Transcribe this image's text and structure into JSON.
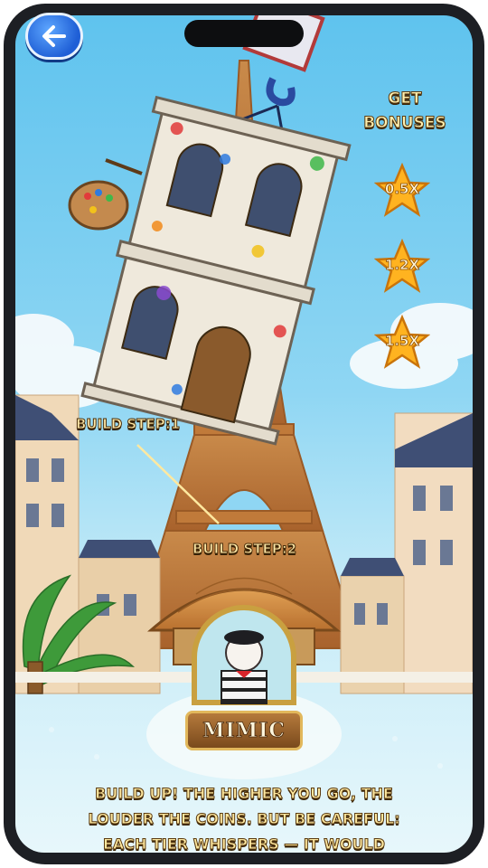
{
  "header": {
    "back_icon": "arrow-left-icon"
  },
  "bonuses": {
    "title_line1": "GET",
    "title_line2": "BONUSES",
    "items": [
      {
        "label": "0.5X"
      },
      {
        "label": "1.2X"
      },
      {
        "label": "1.5X"
      }
    ]
  },
  "build_steps": {
    "step1": "BUILD STEP:1",
    "step2": "BUILD STEP:2"
  },
  "character": {
    "name": "MIMIC"
  },
  "description": {
    "line1": "BUILD UP! THE HIGHER YOU GO, THE",
    "line2": "LOUDER THE COINS. BUT BE CAREFUL:",
    "line3": "EACH TIER WHISPERS — IT WOULD"
  },
  "colors": {
    "sky": "#5fc3ee",
    "star": "#ffb320",
    "text_gold": "#ffe9a0",
    "back_button": "#1f5fd6"
  }
}
